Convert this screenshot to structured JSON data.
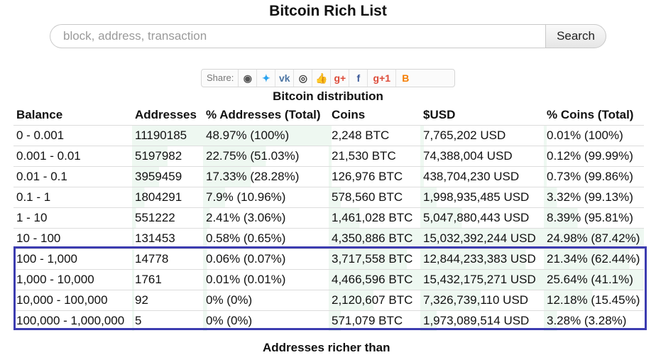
{
  "page": {
    "title": "Bitcoin Rich List",
    "subtitle": "Bitcoin distribution",
    "next_section": "Addresses richer than"
  },
  "search": {
    "placeholder": "block, address, transaction",
    "button_label": "Search"
  },
  "share": {
    "label": "Share:",
    "icons": [
      {
        "name": "reddit-icon",
        "glyph": "◉",
        "color": "#555555"
      },
      {
        "name": "twitter-icon",
        "glyph": "✦",
        "color": "#2aa3ef"
      },
      {
        "name": "vk-icon",
        "glyph": "vk",
        "color": "#4c75a3"
      },
      {
        "name": "weibo-icon",
        "glyph": "◎",
        "color": "#444444"
      },
      {
        "name": "like-icon",
        "glyph": "👍",
        "color": "#3b6ec4"
      },
      {
        "name": "google-plus-icon",
        "glyph": "g+",
        "color": "#dd4b39"
      },
      {
        "name": "facebook-icon",
        "glyph": "f",
        "color": "#3b5998"
      },
      {
        "name": "google-plus-one-icon",
        "glyph": "g+1",
        "color": "#dd4b39"
      },
      {
        "name": "blogger-icon",
        "glyph": "B",
        "color": "#f57d00"
      }
    ]
  },
  "table": {
    "headers": [
      "Balance",
      "Addresses",
      "% Addresses (Total)",
      "Coins",
      "$USD",
      "% Coins (Total)"
    ],
    "bar_color": "#eef8f1",
    "rows": [
      {
        "balance": "0 - 0.001",
        "addresses": "11190185",
        "pct_addr": "48.97% (100%)",
        "coins": "2,248 BTC",
        "usd": "7,765,202 USD",
        "pct_coins": "0.01% (100%)",
        "addr_share": 0.4897
      },
      {
        "balance": "0.001 - 0.01",
        "addresses": "5197982",
        "pct_addr": "22.75% (51.03%)",
        "coins": "21,530 BTC",
        "usd": "74,388,004 USD",
        "pct_coins": "0.12% (99.99%)",
        "addr_share": 0.2275
      },
      {
        "balance": "0.01 - 0.1",
        "addresses": "3959459",
        "pct_addr": "17.33% (28.28%)",
        "coins": "126,976 BTC",
        "usd": "438,704,230 USD",
        "pct_coins": "0.73% (99.86%)",
        "addr_share": 0.1733
      },
      {
        "balance": "0.1 - 1",
        "addresses": "1804291",
        "pct_addr": "7.9% (10.96%)",
        "coins": "578,560 BTC",
        "usd": "1,998,935,485 USD",
        "pct_coins": "3.32% (99.13%)",
        "addr_share": 0.079
      },
      {
        "balance": "1 - 10",
        "addresses": "551222",
        "pct_addr": "2.41% (3.06%)",
        "coins": "1,461,028 BTC",
        "usd": "5,047,880,443 USD",
        "pct_coins": "8.39% (95.81%)",
        "addr_share": 0.0241
      },
      {
        "balance": "10 - 100",
        "addresses": "131453",
        "pct_addr": "0.58% (0.65%)",
        "coins": "4,350,886 BTC",
        "usd": "15,032,392,244 USD",
        "pct_coins": "24.98% (87.42%)",
        "addr_share": 0.0058
      },
      {
        "balance": "100 - 1,000",
        "addresses": "14778",
        "pct_addr": "0.06% (0.07%)",
        "coins": "3,717,558 BTC",
        "usd": "12,844,233,383 USD",
        "pct_coins": "21.34% (62.44%)",
        "addr_share": 0.0006
      },
      {
        "balance": "1,000 - 10,000",
        "addresses": "1761",
        "pct_addr": "0.01% (0.01%)",
        "coins": "4,466,596 BTC",
        "usd": "15,432,175,271 USD",
        "pct_coins": "25.64% (41.1%)",
        "addr_share": 0.0001
      },
      {
        "balance": "10,000 - 100,000",
        "addresses": "92",
        "pct_addr": "0% (0%)",
        "coins": "2,120,607 BTC",
        "usd": "7,326,739,110 USD",
        "pct_coins": "12.18% (15.45%)",
        "addr_share": 0
      },
      {
        "balance": "100,000 - 1,000,000",
        "addresses": "5",
        "pct_addr": "0% (0%)",
        "coins": "571,079 BTC",
        "usd": "1,973,089,514 USD",
        "pct_coins": "3.28% (3.28%)",
        "addr_share": 0
      }
    ]
  },
  "highlight": {
    "color": "#3c3cb0"
  }
}
